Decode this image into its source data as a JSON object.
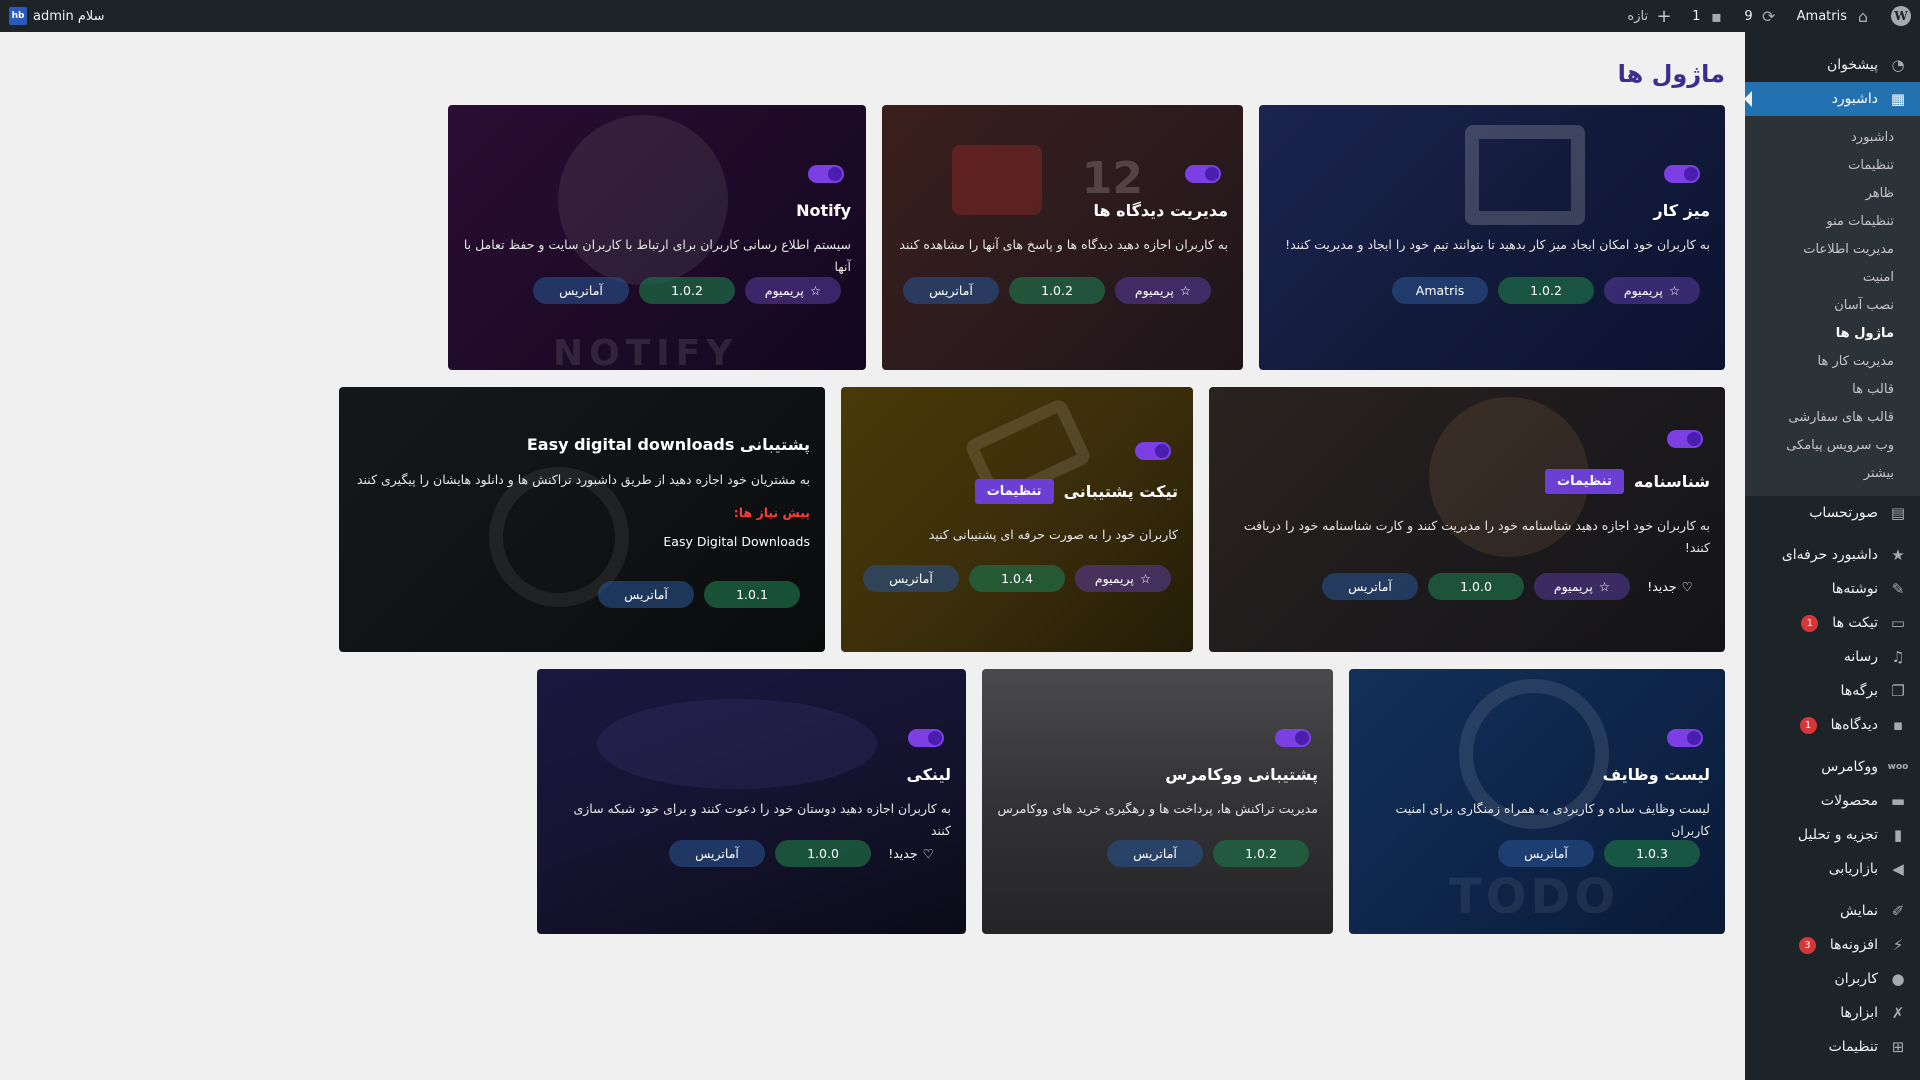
{
  "adminbar": {
    "greeting": "سلام admin",
    "avatar_text": "hb",
    "site_name": "Amatris",
    "updates_count": "9",
    "comments_count": "1",
    "new_label": "تازه",
    "wp_logo": "W"
  },
  "sidebar": {
    "top_items": [
      {
        "label": "پیشخوان",
        "icon": "dashboard-icon"
      },
      {
        "label": "داشبورد",
        "icon": "grid-icon"
      }
    ],
    "submenu": [
      "داشبورد",
      "تنظیمات",
      "ظاهر",
      "تنظیمات منو",
      "مدیریت اطلاعات",
      "امنیت",
      "نصب آسان",
      "ماژول ها",
      "مدیریت کار ها",
      "قالب ها",
      "قالب های سفارشی",
      "وب سرویس پیامکی",
      "بیشتر"
    ],
    "items": [
      {
        "label": "صورتحساب",
        "icon": "invoice-icon"
      },
      {
        "label": "داشبورد حرفه‌ای",
        "icon": "star-icon"
      },
      {
        "label": "نوشته‌ها",
        "icon": "pin-icon"
      },
      {
        "label": "تیکت ها",
        "icon": "ticket-icon",
        "badge": "1"
      },
      {
        "label": "رسانه",
        "icon": "media-icon"
      },
      {
        "label": "برگه‌ها",
        "icon": "pages-icon"
      },
      {
        "label": "دیدگاه‌ها",
        "icon": "comment-icon",
        "badge": "1"
      },
      {
        "label": "ووکامرس",
        "icon": "woo-icon"
      },
      {
        "label": "محصولات",
        "icon": "archive-icon"
      },
      {
        "label": "تجزیه و تحلیل",
        "icon": "chart-icon"
      },
      {
        "label": "بازاریابی",
        "icon": "megaphone-icon"
      },
      {
        "label": "نمایش",
        "icon": "brush-icon"
      },
      {
        "label": "افزونه‌ها",
        "icon": "plug-icon",
        "badge": "3"
      },
      {
        "label": "کاربران",
        "icon": "user-icon"
      },
      {
        "label": "ابزارها",
        "icon": "wrench-icon"
      },
      {
        "label": "تنظیمات",
        "icon": "settings-icon"
      }
    ]
  },
  "page": {
    "title": "ماژول ها"
  },
  "common": {
    "premium": "پریمیوم",
    "author": "آماتریس",
    "new": "جدید!",
    "settings": "تنظیمات",
    "prereq": "پیش نیاز ها:"
  },
  "cards": {
    "workspace": {
      "title": "میز کار",
      "desc": "به کاربران خود امکان ایجاد میز کار بدهید تا بتوانند تیم خود را ایجاد و مدیریت کنند!",
      "version": "1.0.2",
      "author": "Amatris"
    },
    "comments": {
      "title": "مدیریت دیدگاه ها",
      "desc": "به کاربران اجازه دهید دیدگاه ها و پاسخ های آنها را مشاهده کنند",
      "version": "1.0.2",
      "deco": "12"
    },
    "notify": {
      "title": "Notify",
      "desc": "سیستم اطلاع رسانی کاربران برای ارتباط با کاربران سایت و حفظ تعامل با آنها",
      "version": "1.0.2",
      "deco": "NOTIFY"
    },
    "identity": {
      "title": "شناسنامه",
      "desc": "به کاربران خود اجازه دهید شناسنامه خود را مدیریت کنند و کارت شناسنامه خود را دریافت کنند!",
      "version": "1.0.0"
    },
    "ticket": {
      "title": "تیکت پشتیبانی",
      "desc": "کاربران خود را به صورت حرفه ای پشتیبانی کنید",
      "version": "1.0.4"
    },
    "edd": {
      "title": "پشتیبانی Easy digital downloads",
      "desc": "به مشتریان خود اجازه دهید از طریق داشبورد تراکنش ها و دانلود هایشان را پیگیری کنند",
      "prereq_value": "Easy Digital Downloads",
      "version": "1.0.1"
    },
    "todo": {
      "title": "لیست وظایف",
      "desc": "لیست وظایف ساده و کاربردی به همراه زمنگاری برای امنیت کاربران",
      "version": "1.0.3",
      "deco": "TODO"
    },
    "woo": {
      "title": "پشتیبانی ووکامرس",
      "desc": "مدیریت تراکنش ها، پرداخت ها و رهگیری خرید های ووکامرس",
      "version": "1.0.2"
    },
    "linky": {
      "title": "لینکی",
      "desc": "به کاربران اجازه دهید دوستان خود را دعوت کنند و برای خود شبکه سازی کنند",
      "version": "1.0.0"
    }
  }
}
